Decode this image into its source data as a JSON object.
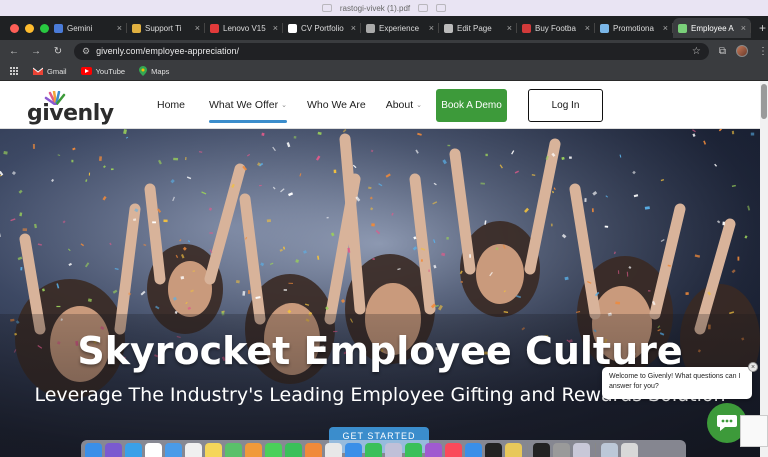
{
  "system": {
    "filename": "rastogi-vivek (1).pdf"
  },
  "tabs": [
    {
      "title": "Gemini",
      "icon": "gemini-icon",
      "color": "#4a7bd8"
    },
    {
      "title": "Support Ti",
      "icon": "support-icon",
      "color": "#e0b040"
    },
    {
      "title": "Lenovo V15",
      "icon": "lenovo-icon",
      "color": "#e23a3a"
    },
    {
      "title": "CV Portfolio",
      "icon": "github-icon",
      "color": "#ffffff"
    },
    {
      "title": "Experience",
      "icon": "globe-icon",
      "color": "#aaaaaa"
    },
    {
      "title": "Edit Page",
      "icon": "wordpress-icon",
      "color": "#bbbbbb"
    },
    {
      "title": "Buy Footba",
      "icon": "shop-icon",
      "color": "#d23a3a"
    },
    {
      "title": "Promotiona",
      "icon": "promo-icon",
      "color": "#7ab6e8"
    },
    {
      "title": "Employee A",
      "icon": "givenly-icon",
      "color": "#7ad07a",
      "active": true
    }
  ],
  "toolbar": {
    "url": "givenly.com/employee-appreciation/"
  },
  "bookmarks": [
    {
      "label": "Gmail",
      "icon": "gmail-icon"
    },
    {
      "label": "YouTube",
      "icon": "youtube-icon"
    },
    {
      "label": "Maps",
      "icon": "maps-icon"
    }
  ],
  "site": {
    "logo": "givenly",
    "nav": [
      {
        "label": "Home",
        "dropdown": false
      },
      {
        "label": "What We Offer",
        "dropdown": true,
        "active": true
      },
      {
        "label": "Who We Are",
        "dropdown": false
      },
      {
        "label": "About",
        "dropdown": true
      }
    ],
    "demo_button": "Book A Demo",
    "login_button": "Log In",
    "hero_title": "Skyrocket Employee Culture",
    "hero_subtitle": "Leverage The Industry's Leading Employee Gifting and Rewards Solution",
    "cta_label": "GET STARTED"
  },
  "chat": {
    "message": "Welcome to Givenly! What questions can I answer for you?"
  },
  "colors": {
    "brand_green": "#3d9a3a",
    "accent_blue": "#3b8dcc"
  }
}
